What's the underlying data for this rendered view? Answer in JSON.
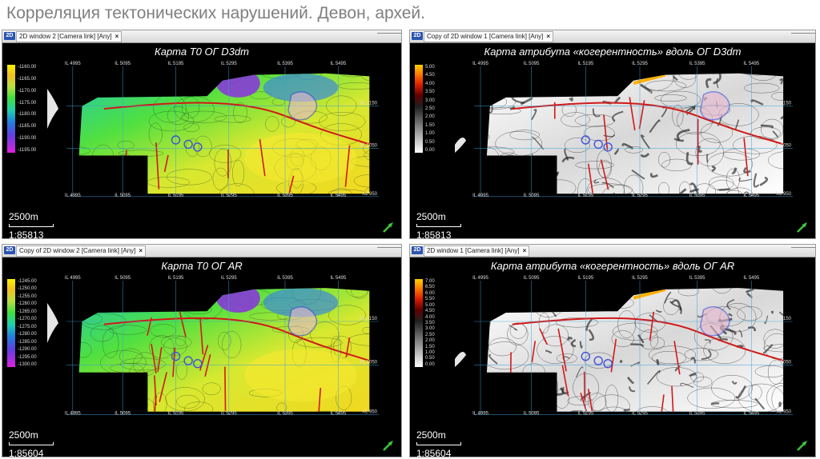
{
  "title": "Корреляция тектонических нарушений. Девон, архей.",
  "windows": [
    {
      "id": "tl",
      "badge": "2D",
      "tab": "2D window 2 [Camera link] [Any]",
      "map_title": "Карта T0 ОГ D3dm",
      "scale_len": "2500m",
      "scale_ratio": "1:85813",
      "legend_ticks": [
        "-1160.00",
        "-1165.00",
        "-1170.00",
        "-1175.00",
        "-1180.00",
        "-1185.00",
        "-1190.00",
        "-1195.00"
      ],
      "type": "t0"
    },
    {
      "id": "tr",
      "badge": "2D",
      "tab": "Copy of 2D window 1 [Camera link] [Any]",
      "map_title": "Карта атрибута «когерентность» вдоль ОГ D3dm",
      "scale_len": "2500m",
      "scale_ratio": "1:85813",
      "legend_ticks": [
        "5.00",
        "4.50",
        "4.00",
        "3.50",
        "3.00",
        "2.50",
        "2.00",
        "1.50",
        "1.00",
        "0.50",
        "0.00"
      ],
      "type": "coh"
    },
    {
      "id": "bl",
      "badge": "2D",
      "tab": "Copy of 2D window 2 [Camera link] [Any]",
      "map_title": "Карта T0 ОГ AR",
      "scale_len": "2500m",
      "scale_ratio": "1:85604",
      "legend_ticks": [
        "-1245.00",
        "-1250.00",
        "-1255.00",
        "-1260.00",
        "-1265.00",
        "-1270.00",
        "-1275.00",
        "-1280.00",
        "-1285.00",
        "-1290.00",
        "-1295.00",
        "-1300.00"
      ],
      "type": "t0"
    },
    {
      "id": "br",
      "badge": "2D",
      "tab": "2D window 1 [Camera link] [Any]",
      "map_title": "Карта атрибута «когерентность» вдоль ОГ AR",
      "scale_len": "2500m",
      "scale_ratio": "1:85604",
      "legend_ticks": [
        "7.00",
        "6.50",
        "6.00",
        "5.50",
        "5.00",
        "4.50",
        "4.00",
        "3.50",
        "3.00",
        "2.50",
        "2.00",
        "1.50",
        "1.00",
        "0.50",
        "0.00"
      ],
      "type": "coh"
    }
  ],
  "grid": {
    "il_labels": [
      "IL 4995",
      "IL 5095",
      "IL 5195",
      "IL 5295",
      "IL 5395",
      "IL 5495"
    ],
    "xl_labels": [
      "XL 1150",
      "XL 1050",
      "XL 950"
    ]
  },
  "colors": {
    "grid_line": "#3fa0d8",
    "t0_low": "#7a18d8",
    "t0_high": "#f7f01a",
    "fault": "#d21818",
    "zone_outline": "#4050d8",
    "arrow": "#3cc43c"
  },
  "icons": {
    "north_arrow": "north-arrow-icon"
  }
}
